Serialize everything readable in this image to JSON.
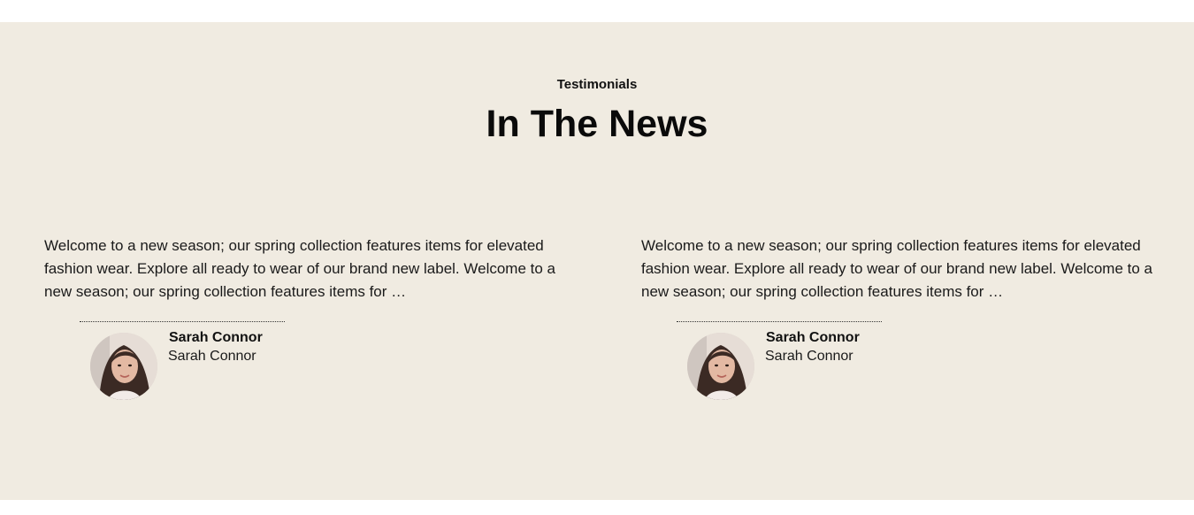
{
  "testimonials": {
    "eyebrow": "Testimonials",
    "title": "In The News",
    "items": [
      {
        "quote": "Welcome to a new season; our spring collection features items for elevated fashion wear. Explore all ready to wear of our brand new label. Welcome to a new season; our spring collection features items for …",
        "name": "Sarah Connor",
        "role": "Sarah Connor",
        "avatar_icon": "person-photo-icon"
      },
      {
        "quote": "Welcome to a new season; our spring collection features items for elevated fashion wear. Explore all ready to wear of our brand new label. Welcome to a new season; our spring collection features items for …",
        "name": "Sarah Connor",
        "role": "Sarah Connor",
        "avatar_icon": "person-photo-icon"
      }
    ]
  },
  "colors": {
    "section_background": "#f0ebe1",
    "page_background": "#ffffff",
    "text": "#111111"
  }
}
